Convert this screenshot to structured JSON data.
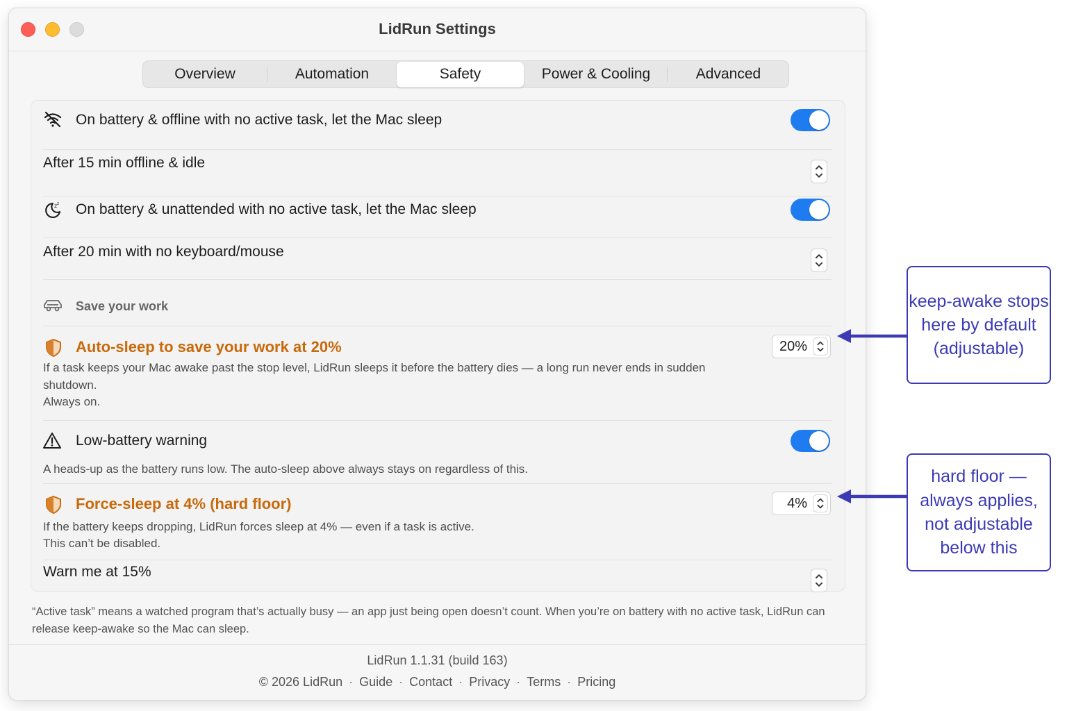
{
  "window": {
    "title": "LidRun Settings"
  },
  "tabs": [
    {
      "label": "Overview",
      "active": false
    },
    {
      "label": "Automation",
      "active": false
    },
    {
      "label": "Safety",
      "active": true
    },
    {
      "label": "Power & Cooling",
      "active": false
    },
    {
      "label": "Advanced",
      "active": false
    }
  ],
  "offline_sleep": {
    "icon": "wifi-off-icon",
    "label": "On battery & offline with no active task, let the Mac sleep",
    "enabled": true,
    "delay_label": "After 15 min offline & idle"
  },
  "unattended_sleep": {
    "icon": "moon-sleep-icon",
    "label": "On battery & unattended with no active task, let the Mac sleep",
    "enabled": true,
    "delay_label": "After 20 min with no keyboard/mouse"
  },
  "save_work": {
    "icon": "car-icon",
    "section_label": "Save your work",
    "auto_sleep": {
      "icon": "shield-icon",
      "title": "Auto-sleep to save your work at 20%",
      "value": "20%",
      "description": "If a task keeps your Mac awake past the stop level, LidRun sleeps it before the battery dies — a long run never ends in sudden shutdown.",
      "note": "Always on."
    }
  },
  "low_battery": {
    "icon": "warning-triangle-icon",
    "label": "Low-battery warning",
    "enabled": true,
    "description": "A heads-up as the battery runs low. The auto-sleep above always stays on regardless of this.",
    "force_sleep": {
      "icon": "shield-icon",
      "title": "Force-sleep at 4% (hard floor)",
      "value": "4%",
      "description": "If the battery keeps dropping, LidRun forces sleep at 4% — even if a task is active.",
      "note": "This can’t be disabled."
    },
    "warn_label": "Warn me at 15%"
  },
  "footnote": "“Active task” means a watched program that’s actually busy — an app just being open doesn’t count. When you’re on battery with no active task, LidRun can release keep-awake so the Mac can sleep.",
  "footer": {
    "version": "LidRun 1.1.31 (build 163)",
    "copyright": "© 2026 LidRun",
    "links": [
      "Guide",
      "Contact",
      "Privacy",
      "Terms",
      "Pricing"
    ]
  },
  "annotations": [
    {
      "text": "keep-awake stops here by default (adjustable)"
    },
    {
      "text": "hard floor — always applies, not adjustable below this"
    }
  ],
  "colors": {
    "accent_blue": "#1f7cf0",
    "warning_orange": "#c8690a",
    "annotation_indigo": "#3c3ab4"
  }
}
